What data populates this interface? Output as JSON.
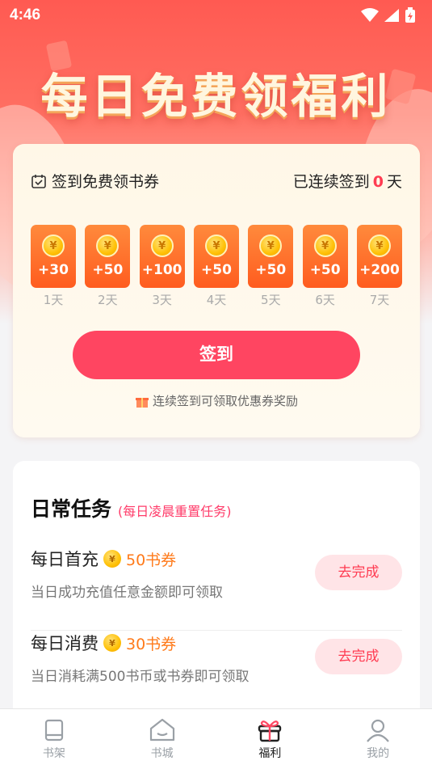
{
  "status_bar": {
    "time": "4:46"
  },
  "banner": {
    "title": "每日免费领福利"
  },
  "sign_in": {
    "title": "签到免费领书券",
    "streak_prefix": "已连续签到",
    "streak_count": "0",
    "streak_suffix": "天",
    "days": [
      {
        "amount": "+30",
        "label": "1天"
      },
      {
        "amount": "+50",
        "label": "2天"
      },
      {
        "amount": "+100",
        "label": "3天"
      },
      {
        "amount": "+50",
        "label": "4天"
      },
      {
        "amount": "+50",
        "label": "5天"
      },
      {
        "amount": "+50",
        "label": "6天"
      },
      {
        "amount": "+200",
        "label": "7天"
      }
    ],
    "coin_symbol": "¥",
    "button_label": "签到",
    "tip": "连续签到可领取优惠券奖励"
  },
  "tasks": {
    "title": "日常任务",
    "subtitle": "(每日凌晨重置任务)",
    "items": [
      {
        "name": "每日首充",
        "reward": "50书券",
        "desc": "当日成功充值任意金额即可领取",
        "button": "去完成"
      },
      {
        "name": "每日消费",
        "reward": "30书券",
        "desc": "当日消耗满500书币或书券即可领取",
        "button": "去完成"
      }
    ]
  },
  "tabbar": {
    "items": [
      {
        "label": "书架",
        "icon": "bookshelf-icon"
      },
      {
        "label": "书城",
        "icon": "bookstore-icon"
      },
      {
        "label": "福利",
        "icon": "gift-icon"
      },
      {
        "label": "我的",
        "icon": "profile-icon"
      }
    ],
    "active": "福利"
  },
  "colors": {
    "accent": "#ff4561",
    "coin_orange": "#ff6a2a",
    "reward_orange": "#ff7a1a"
  }
}
